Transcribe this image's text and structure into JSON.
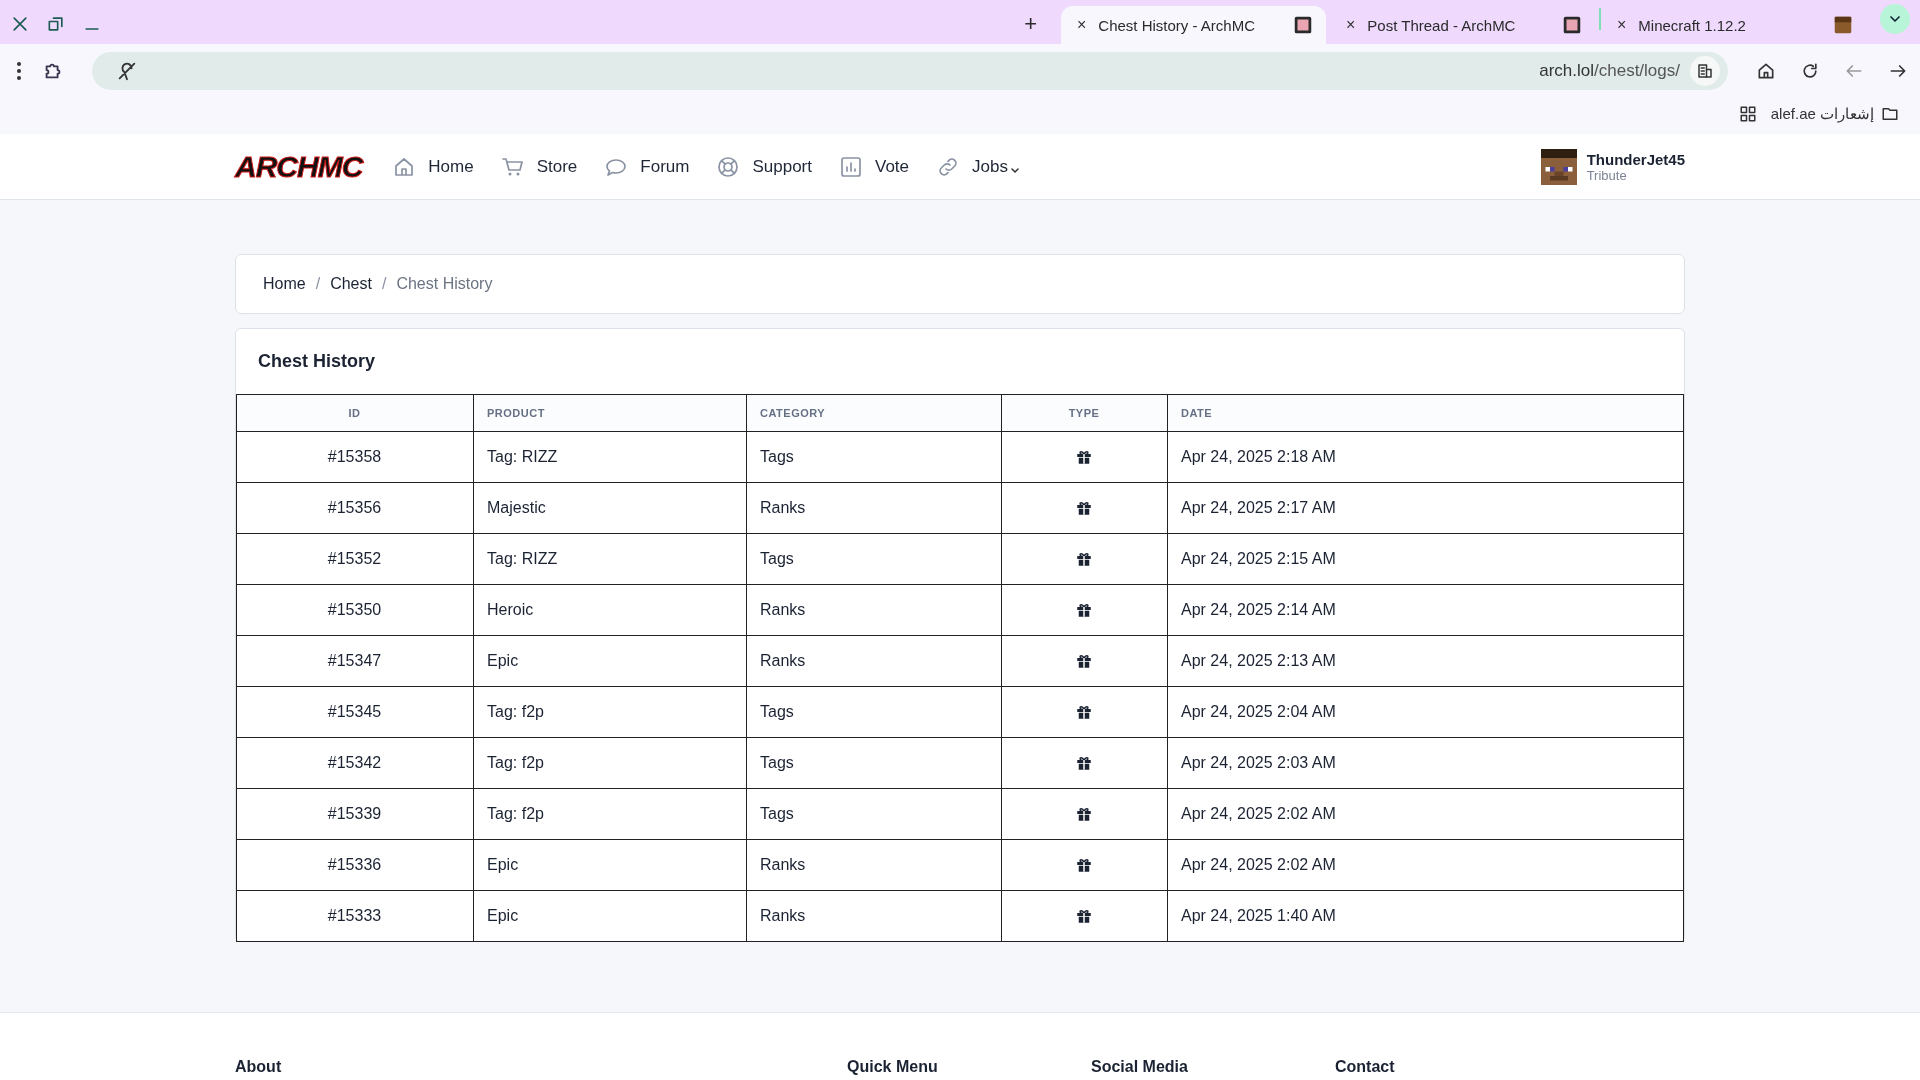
{
  "browser": {
    "new_tab": "+",
    "tabs": [
      {
        "close": "×",
        "title": "Chest History - ArchMC",
        "selected": true,
        "kind": "arch"
      },
      {
        "close": "×",
        "title": "Post Thread - ArchMC",
        "selected": false,
        "kind": "arch"
      },
      {
        "close": "×",
        "title": "Minecraft 1.12.2",
        "selected": false,
        "kind": "block"
      }
    ],
    "url": {
      "host": "arch.lol",
      "path": "/chest/logs/"
    },
    "bookmarks": [
      {
        "label": "إشعارات alef.ae"
      }
    ]
  },
  "site_nav": {
    "logo": "ARCHMC",
    "items": [
      {
        "label": "Home",
        "kind": "home",
        "dropdown": false
      },
      {
        "label": "Store",
        "kind": "cart",
        "dropdown": false
      },
      {
        "label": "Forum",
        "kind": "chat",
        "dropdown": false
      },
      {
        "label": "Support",
        "kind": "lifebuoy",
        "dropdown": false
      },
      {
        "label": "Vote",
        "kind": "chart",
        "dropdown": false
      },
      {
        "label": "Jobs",
        "kind": "link",
        "dropdown": true
      }
    ],
    "user": {
      "name": "ThunderJet45",
      "rank": "Tribute"
    }
  },
  "breadcrumb": [
    {
      "label": "Home",
      "current": false
    },
    {
      "separator": "/",
      "label": "Chest",
      "current": false
    },
    {
      "separator": "/",
      "label": "Chest History",
      "current": true
    }
  ],
  "card": {
    "title": "Chest History"
  },
  "table": {
    "columns": [
      "ID",
      "PRODUCT",
      "CATEGORY",
      "TYPE",
      "DATE"
    ],
    "rows": [
      {
        "id": "#15358",
        "product": "Tag: RIZZ",
        "category": "Tags",
        "kind": "gift",
        "date": "Apr 24, 2025 2:18 AM"
      },
      {
        "id": "#15356",
        "product": "Majestic",
        "category": "Ranks",
        "kind": "gift",
        "date": "Apr 24, 2025 2:17 AM"
      },
      {
        "id": "#15352",
        "product": "Tag: RIZZ",
        "category": "Tags",
        "kind": "gift",
        "date": "Apr 24, 2025 2:15 AM"
      },
      {
        "id": "#15350",
        "product": "Heroic",
        "category": "Ranks",
        "kind": "gift",
        "date": "Apr 24, 2025 2:14 AM"
      },
      {
        "id": "#15347",
        "product": "Epic",
        "category": "Ranks",
        "kind": "gift",
        "date": "Apr 24, 2025 2:13 AM"
      },
      {
        "id": "#15345",
        "product": "Tag: f2p",
        "category": "Tags",
        "kind": "gift",
        "date": "Apr 24, 2025 2:04 AM"
      },
      {
        "id": "#15342",
        "product": "Tag: f2p",
        "category": "Tags",
        "kind": "gift",
        "date": "Apr 24, 2025 2:03 AM"
      },
      {
        "id": "#15339",
        "product": "Tag: f2p",
        "category": "Tags",
        "kind": "gift",
        "date": "Apr 24, 2025 2:02 AM"
      },
      {
        "id": "#15336",
        "product": "Epic",
        "category": "Ranks",
        "kind": "gift",
        "date": "Apr 24, 2025 2:02 AM"
      },
      {
        "id": "#15333",
        "product": "Epic",
        "category": "Ranks",
        "kind": "gift",
        "date": "Apr 24, 2025 1:40 AM"
      }
    ]
  },
  "footer": {
    "headings": [
      "About",
      "Quick Menu",
      "Social Media",
      "Contact"
    ]
  }
}
